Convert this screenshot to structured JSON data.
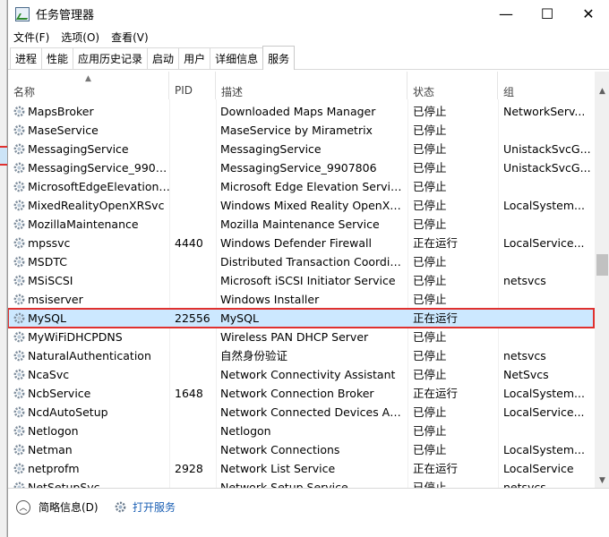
{
  "window": {
    "title": "任务管理器",
    "minimize_glyph": "—",
    "maximize_glyph": "☐",
    "close_glyph": "✕"
  },
  "menu": [
    "文件(F)",
    "选项(O)",
    "查看(V)"
  ],
  "tabs": [
    "进程",
    "性能",
    "应用历史记录",
    "启动",
    "用户",
    "详细信息",
    "服务"
  ],
  "active_tab": "服务",
  "columns": {
    "name": "名称",
    "pid": "PID",
    "desc": "描述",
    "status": "状态",
    "group": "组"
  },
  "services": [
    {
      "name": "MapsBroker",
      "pid": "",
      "desc": "Downloaded Maps Manager",
      "status": "已停止",
      "group": "NetworkServ..."
    },
    {
      "name": "MaseService",
      "pid": "",
      "desc": "MaseService by Mirametrix",
      "status": "已停止",
      "group": ""
    },
    {
      "name": "MessagingService",
      "pid": "",
      "desc": "MessagingService",
      "status": "已停止",
      "group": "UnistackSvcG..."
    },
    {
      "name": "MessagingService_99078...",
      "pid": "",
      "desc": "MessagingService_9907806",
      "status": "已停止",
      "group": "UnistackSvcG..."
    },
    {
      "name": "MicrosoftEdgeElevationS...",
      "pid": "",
      "desc": "Microsoft Edge Elevation Service...",
      "status": "已停止",
      "group": ""
    },
    {
      "name": "MixedRealityOpenXRSvc",
      "pid": "",
      "desc": "Windows Mixed Reality OpenXR ...",
      "status": "已停止",
      "group": "LocalSystem..."
    },
    {
      "name": "MozillaMaintenance",
      "pid": "",
      "desc": "Mozilla Maintenance Service",
      "status": "已停止",
      "group": ""
    },
    {
      "name": "mpssvc",
      "pid": "4440",
      "desc": "Windows Defender Firewall",
      "status": "正在运行",
      "group": "LocalService..."
    },
    {
      "name": "MSDTC",
      "pid": "",
      "desc": "Distributed Transaction Coordina...",
      "status": "已停止",
      "group": ""
    },
    {
      "name": "MSiSCSI",
      "pid": "",
      "desc": "Microsoft iSCSI Initiator Service",
      "status": "已停止",
      "group": "netsvcs"
    },
    {
      "name": "msiserver",
      "pid": "",
      "desc": "Windows Installer",
      "status": "已停止",
      "group": ""
    },
    {
      "name": "MySQL",
      "pid": "22556",
      "desc": "MySQL",
      "status": "正在运行",
      "group": "",
      "selected": true
    },
    {
      "name": "MyWiFiDHCPDNS",
      "pid": "",
      "desc": "Wireless PAN DHCP Server",
      "status": "已停止",
      "group": ""
    },
    {
      "name": "NaturalAuthentication",
      "pid": "",
      "desc": "自然身份验证",
      "status": "已停止",
      "group": "netsvcs"
    },
    {
      "name": "NcaSvc",
      "pid": "",
      "desc": "Network Connectivity Assistant",
      "status": "已停止",
      "group": "NetSvcs"
    },
    {
      "name": "NcbService",
      "pid": "1648",
      "desc": "Network Connection Broker",
      "status": "正在运行",
      "group": "LocalSystem..."
    },
    {
      "name": "NcdAutoSetup",
      "pid": "",
      "desc": "Network Connected Devices Aut...",
      "status": "已停止",
      "group": "LocalService..."
    },
    {
      "name": "Netlogon",
      "pid": "",
      "desc": "Netlogon",
      "status": "已停止",
      "group": ""
    },
    {
      "name": "Netman",
      "pid": "",
      "desc": "Network Connections",
      "status": "已停止",
      "group": "LocalSystem..."
    },
    {
      "name": "netprofm",
      "pid": "2928",
      "desc": "Network List Service",
      "status": "正在运行",
      "group": "LocalService"
    },
    {
      "name": "NetSetupSvc",
      "pid": "",
      "desc": "Network Setup Service",
      "status": "已停止",
      "group": "netsvcs"
    }
  ],
  "bottom": {
    "collapse_label": "简略信息(D)",
    "open_services_label": "打开服务"
  },
  "colors": {
    "selection_bg": "#cce8ff",
    "highlight_outline": "#e0312f",
    "link": "#1a5fb4"
  }
}
